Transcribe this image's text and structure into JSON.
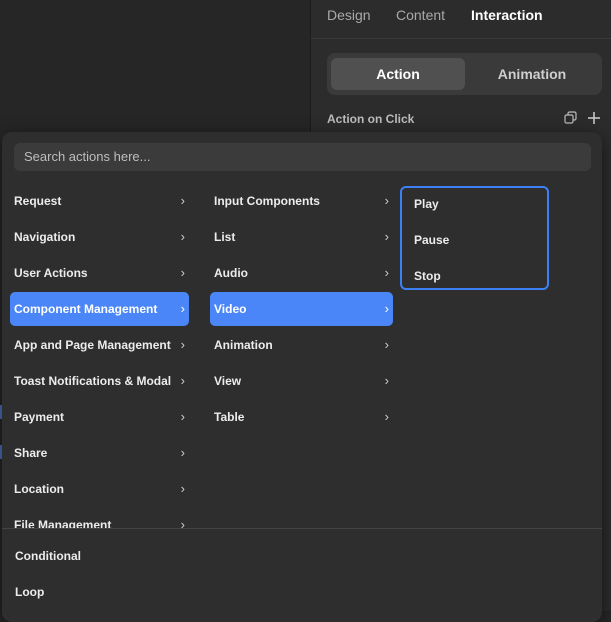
{
  "panel": {
    "tabs": [
      "Design",
      "Content",
      "Interaction"
    ],
    "active_tab": "Interaction",
    "segment": {
      "action": "Action",
      "animation": "Animation",
      "active": "Action"
    },
    "section_label": "Action on Click",
    "icons": [
      "copy-icon",
      "plus-icon"
    ]
  },
  "popup": {
    "search_placeholder": "Search actions here...",
    "column1": [
      "Request",
      "Navigation",
      "User Actions",
      "Component Management",
      "App and Page Management",
      "Toast Notifications & Modal",
      "Payment",
      "Share",
      "Location",
      "File Management"
    ],
    "column1_active": "Component Management",
    "column2": [
      "Input Components",
      "List",
      "Audio",
      "Video",
      "Animation",
      "View",
      "Table"
    ],
    "column2_active": "Video",
    "column3": [
      "Play",
      "Pause",
      "Stop"
    ],
    "footer": [
      "Conditional",
      "Loop"
    ],
    "accent_color": "#4a86f7"
  }
}
